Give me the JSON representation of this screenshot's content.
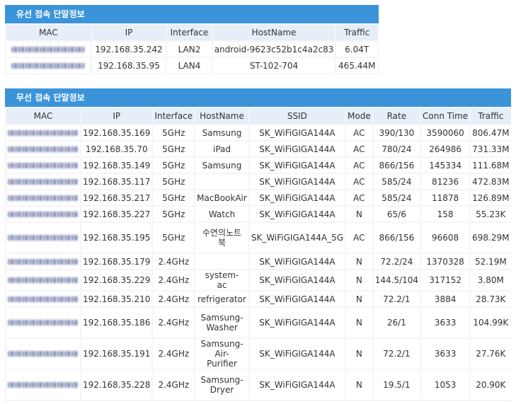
{
  "wired": {
    "title": "유선 접속 단말정보",
    "headers": [
      "MAC",
      "IP",
      "Interface",
      "HostName",
      "Traffic"
    ],
    "rows": [
      {
        "ip": "192.168.35.242",
        "interface": "LAN2",
        "hostname": "android-9623c52b1c4a2c83",
        "traffic": "6.04T"
      },
      {
        "ip": "192.168.35.95",
        "interface": "LAN4",
        "hostname": "ST-102-704",
        "traffic": "465.44M"
      }
    ]
  },
  "wireless": {
    "title": "무선 접속 단말정보",
    "headers": [
      "MAC",
      "IP",
      "Interface",
      "HostName",
      "SSID",
      "Mode",
      "Rate",
      "Conn Time",
      "Traffic"
    ],
    "rows": [
      {
        "ip": "192.168.35.169",
        "interface": "5GHz",
        "hostname": "Samsung",
        "ssid": "SK_WiFiGIGA144A",
        "mode": "AC",
        "rate": "390/130",
        "conn_time": "3590060",
        "traffic": "806.47M"
      },
      {
        "ip": "192.168.35.70",
        "interface": "5GHz",
        "hostname": "iPad",
        "ssid": "SK_WiFiGIGA144A",
        "mode": "AC",
        "rate": "780/24",
        "conn_time": "264986",
        "traffic": "731.33M"
      },
      {
        "ip": "192.168.35.149",
        "interface": "5GHz",
        "hostname": "Samsung",
        "ssid": "SK_WiFiGIGA144A",
        "mode": "AC",
        "rate": "866/156",
        "conn_time": "145334",
        "traffic": "111.68M"
      },
      {
        "ip": "192.168.35.117",
        "interface": "5GHz",
        "hostname": "",
        "ssid": "SK_WiFiGIGA144A",
        "mode": "AC",
        "rate": "585/24",
        "conn_time": "81236",
        "traffic": "472.83M"
      },
      {
        "ip": "192.168.35.217",
        "interface": "5GHz",
        "hostname": "MacBookAir",
        "ssid": "SK_WiFiGIGA144A",
        "mode": "AC",
        "rate": "585/24",
        "conn_time": "11878",
        "traffic": "126.89M"
      },
      {
        "ip": "192.168.35.227",
        "interface": "5GHz",
        "hostname": "Watch",
        "ssid": "SK_WiFiGIGA144A",
        "mode": "N",
        "rate": "65/6",
        "conn_time": "158",
        "traffic": "55.23K"
      },
      {
        "ip": "192.168.35.195",
        "interface": "5GHz",
        "hostname": "수연의노트북",
        "ssid": "SK_WiFiGIGA144A_5G",
        "mode": "AC",
        "rate": "866/156",
        "conn_time": "96608",
        "traffic": "698.29M"
      },
      {
        "ip": "192.168.35.179",
        "interface": "2.4GHz",
        "hostname": "",
        "ssid": "SK_WiFiGIGA144A",
        "mode": "N",
        "rate": "72.2/24",
        "conn_time": "1370328",
        "traffic": "52.19M"
      },
      {
        "ip": "192.168.35.229",
        "interface": "2.4GHz",
        "hostname": "system-ac",
        "ssid": "SK_WiFiGIGA144A",
        "mode": "N",
        "rate": "144.5/104",
        "conn_time": "317152",
        "traffic": "3.80M"
      },
      {
        "ip": "192.168.35.210",
        "interface": "2.4GHz",
        "hostname": "refrigerator",
        "ssid": "SK_WiFiGIGA144A",
        "mode": "N",
        "rate": "72.2/1",
        "conn_time": "3884",
        "traffic": "28.73K"
      },
      {
        "ip": "192.168.35.186",
        "interface": "2.4GHz",
        "hostname": "Samsung-Washer",
        "ssid": "SK_WiFiGIGA144A",
        "mode": "N",
        "rate": "26/1",
        "conn_time": "3633",
        "traffic": "104.99K"
      },
      {
        "ip": "192.168.35.191",
        "interface": "2.4GHz",
        "hostname": "Samsung-Air-Purifier",
        "ssid": "SK_WiFiGIGA144A",
        "mode": "N",
        "rate": "72.2/1",
        "conn_time": "3633",
        "traffic": "27.76K"
      },
      {
        "ip": "192.168.35.228",
        "interface": "2.4GHz",
        "hostname": "Samsung-Dryer",
        "ssid": "SK_WiFiGIGA144A",
        "mode": "N",
        "rate": "19.5/1",
        "conn_time": "1053",
        "traffic": "20.90K"
      }
    ]
  }
}
